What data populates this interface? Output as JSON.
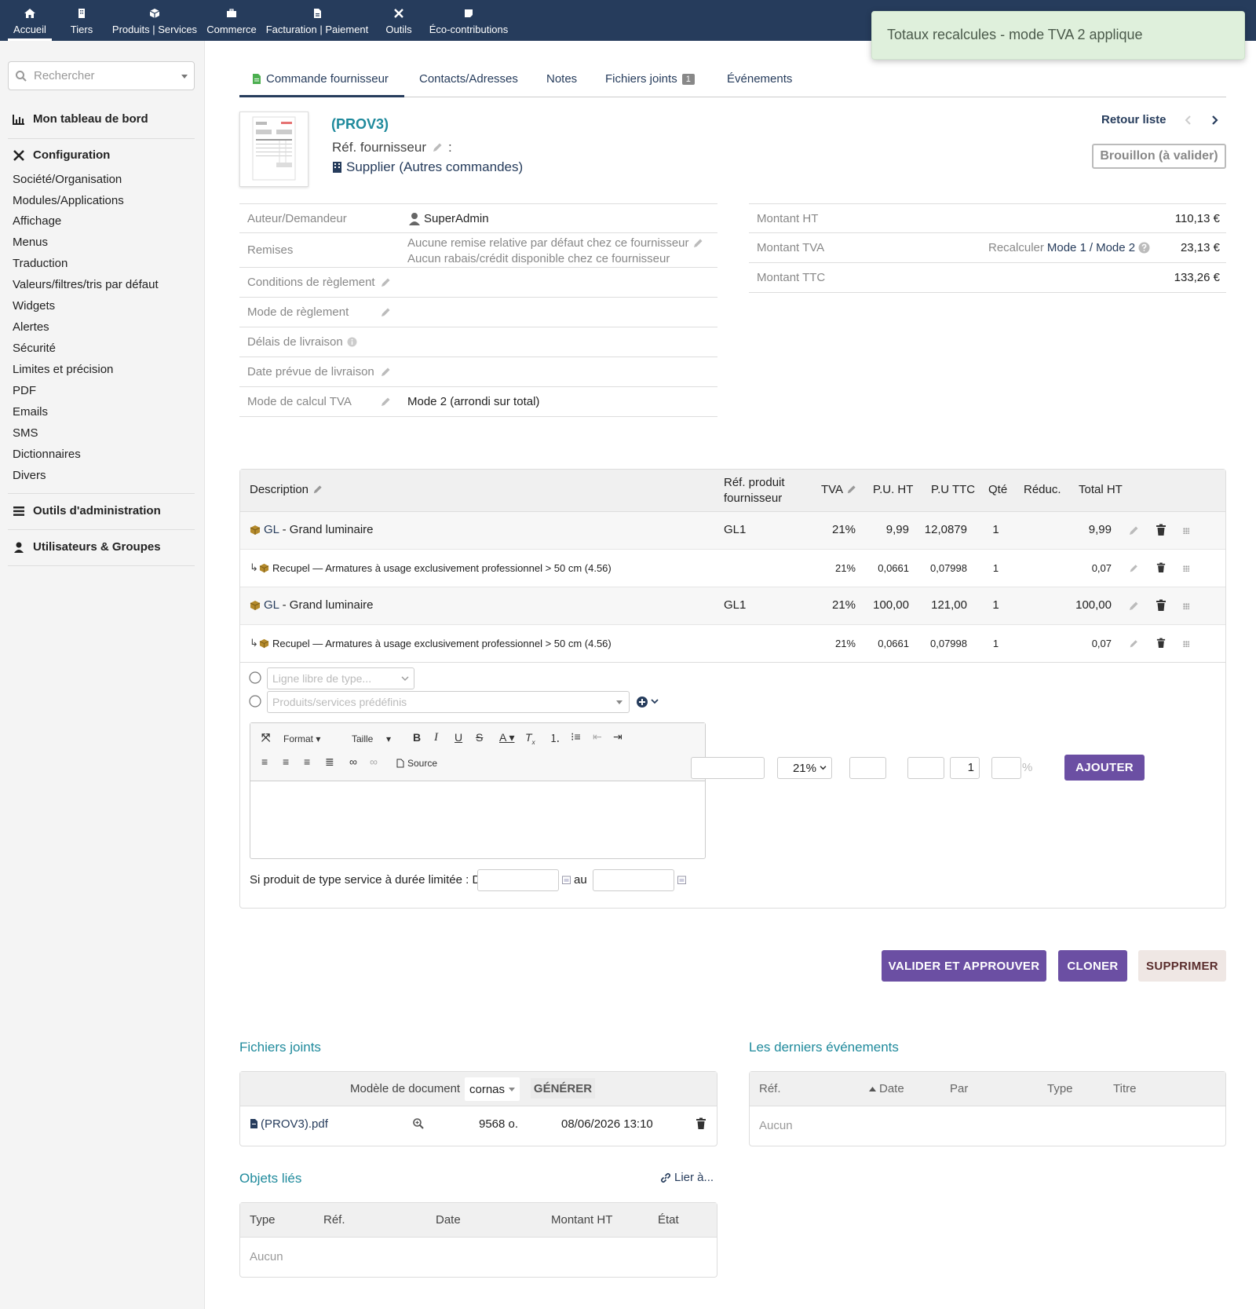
{
  "topnav": {
    "items": [
      {
        "label": "Accueil",
        "icon": "home-icon"
      },
      {
        "label": "Tiers",
        "icon": "building-icon"
      },
      {
        "label": "Produits | Services",
        "icon": "box-icon"
      },
      {
        "label": "Commerce",
        "icon": "briefcase-icon"
      },
      {
        "label": "Facturation | Paiement",
        "icon": "invoice-icon"
      },
      {
        "label": "Outils",
        "icon": "tools-icon"
      },
      {
        "label": "Éco-contributions",
        "icon": "note-icon"
      }
    ]
  },
  "toast": {
    "message": "Totaux recalcules - mode TVA 2 applique"
  },
  "sidebar": {
    "search_placeholder": "Rechercher",
    "dashboard": "Mon tableau de bord",
    "config_title": "Configuration",
    "config_items": [
      "Société/Organisation",
      "Modules/Applications",
      "Affichage",
      "Menus",
      "Traduction",
      "Valeurs/filtres/tris par défaut",
      "Widgets",
      "Alertes",
      "Sécurité",
      "Limites et précision",
      "PDF",
      "Emails",
      "SMS",
      "Dictionnaires",
      "Divers"
    ],
    "admin_tools": "Outils d'administration",
    "users_groups": "Utilisateurs & Groupes"
  },
  "tabs": [
    {
      "label": "Commande fournisseur"
    },
    {
      "label": "Contacts/Adresses"
    },
    {
      "label": "Notes"
    },
    {
      "label": "Fichiers joints",
      "badge": "1"
    },
    {
      "label": "Événements"
    }
  ],
  "header": {
    "ref": "(PROV3)",
    "ref_supplier_label": "Réf. fournisseur",
    "ref_supplier_colon": ":",
    "supplier": "Supplier",
    "supplier_extra": "(Autres commandes)",
    "back_to_list": "Retour liste",
    "status": "Brouillon (à valider)"
  },
  "fields": {
    "author_label": "Auteur/Demandeur",
    "author_value": "SuperAdmin",
    "discounts_label": "Remises",
    "discount_line1": "Aucune remise relative par défaut chez ce fournisseur",
    "discount_line2": "Aucun rabais/crédit disponible chez ce fournisseur",
    "payment_terms_label": "Conditions de règlement",
    "payment_mode_label": "Mode de règlement",
    "delivery_delay_label": "Délais de livraison",
    "delivery_date_label": "Date prévue de livraison",
    "vat_calc_label": "Mode de calcul TVA",
    "vat_calc_value": "Mode 2 (arrondi sur total)"
  },
  "totals": {
    "ht_label": "Montant HT",
    "ht_value": "110,13 €",
    "tva_label": "Montant TVA",
    "recalc_label": "Recalculer",
    "mode1": "Mode 1",
    "slash": "/",
    "mode2": "Mode 2",
    "tva_value": "23,13 €",
    "ttc_label": "Montant TTC",
    "ttc_value": "133,26 €"
  },
  "lines": {
    "headers": {
      "description": "Description",
      "ref_product": "Réf. produit",
      "ref_product2": "fournisseur",
      "tva": "TVA",
      "pu_ht": "P.U. HT",
      "pu_ttc": "P.U TTC",
      "qty": "Qté",
      "discount": "Réduc.",
      "total_ht": "Total HT"
    },
    "rows": [
      {
        "ref": "GL",
        "desc": " - Grand luminaire",
        "supplier_ref": "GL1",
        "tva": "21%",
        "pu_ht": "9,99",
        "pu_ttc": "12,0879",
        "qty": "1",
        "total": "9,99",
        "sub": false
      },
      {
        "desc": "Recupel — Armatures à usage exclusivement professionnel > 50 cm (4.56)",
        "tva": "21%",
        "pu_ht": "0,0661",
        "pu_ttc": "0,07998",
        "qty": "1",
        "total": "0,07",
        "sub": true
      },
      {
        "ref": "GL",
        "desc": " - Grand luminaire",
        "supplier_ref": "GL1",
        "tva": "21%",
        "pu_ht": "100,00",
        "pu_ttc": "121,00",
        "qty": "1",
        "total": "100,00",
        "sub": false
      },
      {
        "desc": "Recupel — Armatures à usage exclusivement professionnel > 50 cm (4.56)",
        "tva": "21%",
        "pu_ht": "0,0661",
        "pu_ttc": "0,07998",
        "qty": "1",
        "total": "0,07",
        "sub": true
      }
    ]
  },
  "addline": {
    "free_line_placeholder": "Ligne libre de type...",
    "predef_placeholder": "Produits/services prédéfinis",
    "format": "Format",
    "size": "Taille",
    "source": "Source",
    "vat_select": "21%",
    "qty_value": "1",
    "percent": "%",
    "add_button": "AJOUTER",
    "service_label": "Si produit de type service à durée limitée : Du",
    "to_label": "au"
  },
  "actions": {
    "validate": "VALIDER ET APPROUVER",
    "clone": "CLONER",
    "delete": "SUPPRIMER"
  },
  "files": {
    "title": "Fichiers joints",
    "model_label": "Modèle de document",
    "model_value": "cornas",
    "generate": "GÉNÉRER",
    "file_name": "(PROV3).pdf",
    "file_size": "9568 o.",
    "file_date": "08/06/2026 13:10"
  },
  "linked": {
    "title": "Objets liés",
    "link_to": "Lier à...",
    "cols": [
      "Type",
      "Réf.",
      "Date",
      "Montant HT",
      "État"
    ],
    "empty": "Aucun"
  },
  "events": {
    "title": "Les derniers événements",
    "cols": [
      "Réf.",
      "Date",
      "Par",
      "Type",
      "Titre"
    ],
    "empty": "Aucun"
  },
  "colors": {
    "nav": "#263c5c",
    "accent": "#6b4fa3",
    "teal": "#1f8a9c"
  }
}
